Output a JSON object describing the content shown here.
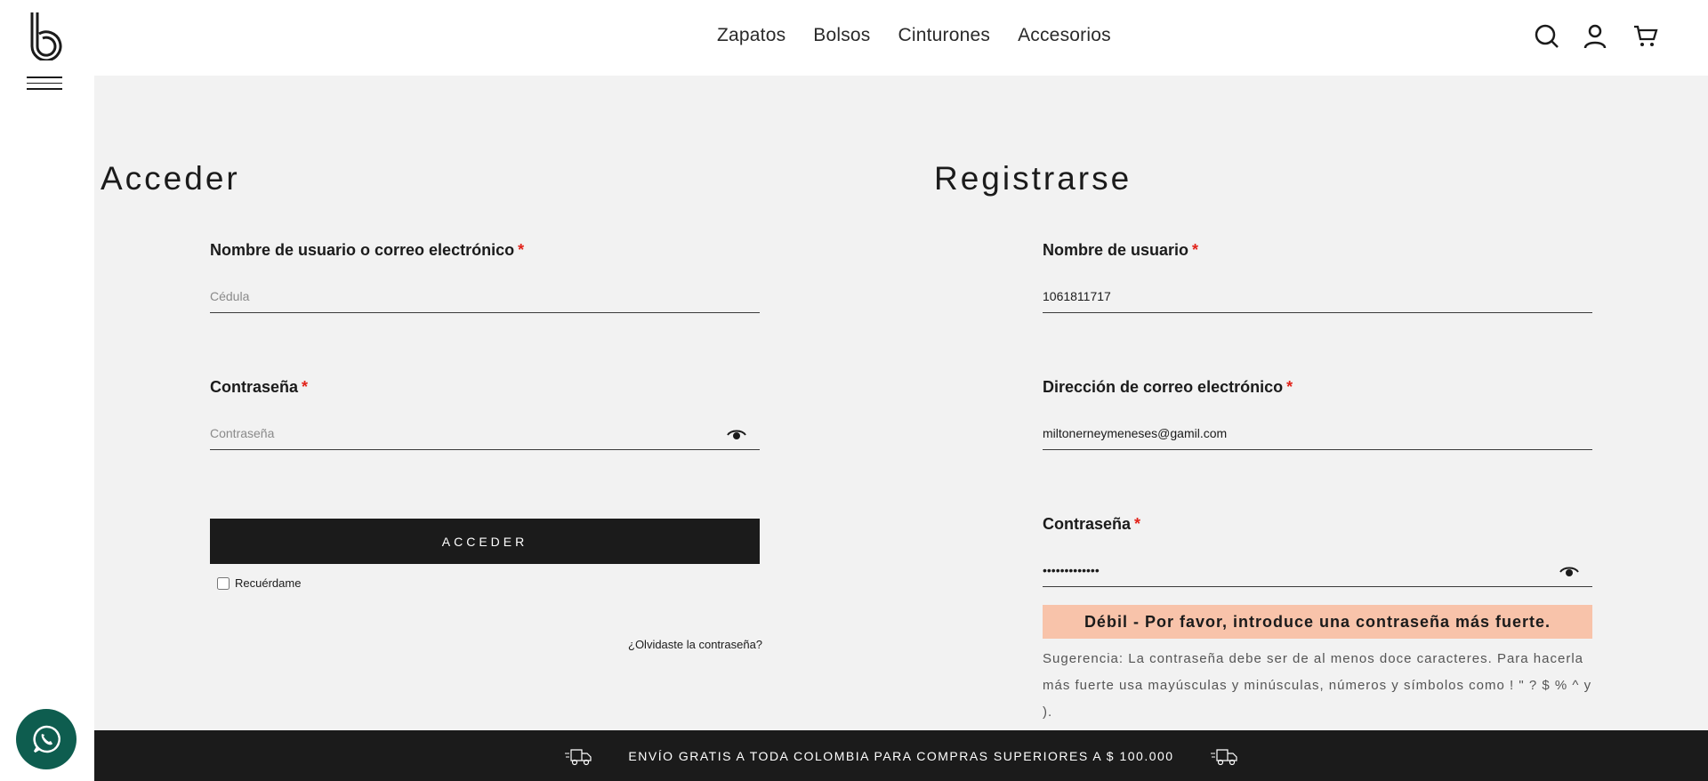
{
  "brand": {
    "logo_icon": "b-logo-icon"
  },
  "nav": {
    "items": [
      "Zapatos",
      "Bolsos",
      "Cinturones",
      "Accesorios"
    ]
  },
  "header_icons": [
    "search-icon",
    "user-icon",
    "cart-icon"
  ],
  "login": {
    "title": "Acceder",
    "username_label": "Nombre de usuario o correo electrónico",
    "username_placeholder": "Cédula",
    "password_label": "Contraseña",
    "password_placeholder": "Contraseña",
    "submit_label": "ACCEDER",
    "remember_label": "Recuérdame",
    "forgot_label": "¿Olvidaste la contraseña?"
  },
  "register": {
    "title": "Registrarse",
    "username_label": "Nombre de usuario",
    "username_value": "1061811717",
    "email_label": "Dirección de correo electrónico",
    "email_value": "miltonerneymeneses@gamil.com",
    "password_label": "Contraseña",
    "password_value": "•••••••••••••",
    "strength_text": "Débil - Por favor, introduce una contraseña más fuerte.",
    "hint_text": "Sugerencia: La contraseña debe ser de al menos doce caracteres. Para hacerla más fuerte usa mayúsculas y minúsculas, números y símbolos como ! \" ? $ % ^ y )."
  },
  "required_mark": "*",
  "promo": {
    "text": "ENVÍO GRATIS A TODA COLOMBIA PARA COMPRAS SUPERIORES A $ 100.000"
  },
  "colors": {
    "accent_dark": "#1b1b1b",
    "background": "#f2f2f2",
    "required": "#e2231a",
    "weak_strength": "#f8c3aa",
    "whatsapp": "#0e5d4f"
  }
}
